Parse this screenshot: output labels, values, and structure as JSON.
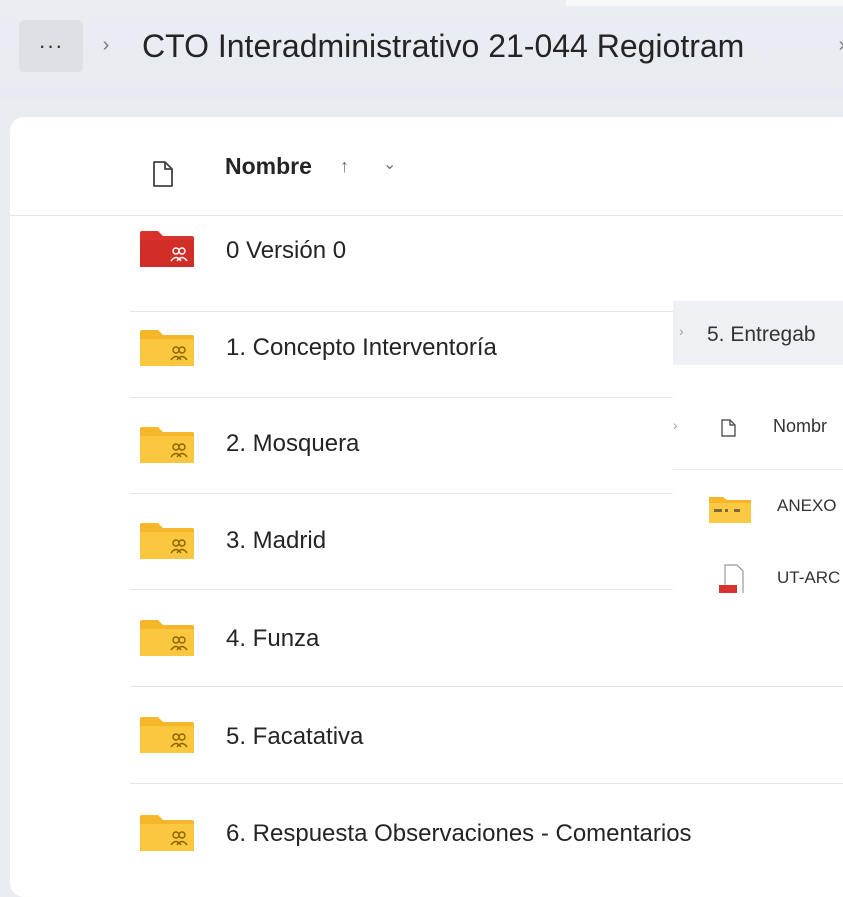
{
  "breadcrumb": {
    "more_label": "···",
    "separator": "›",
    "title": "CTO Interadministrativo 21-044 Regiotram",
    "trailing_separator": "›"
  },
  "list_header": {
    "column_name": "Nombre",
    "sort_arrow": "↑",
    "sort_caret": "⌄"
  },
  "folders": [
    {
      "label": "0 Versión 0",
      "color": "#d9312b"
    },
    {
      "label": "1. Concepto Interventoría",
      "color": "#f5b62a"
    },
    {
      "label": "2. Mosquera",
      "color": "#f5b62a"
    },
    {
      "label": "3. Madrid",
      "color": "#f5b62a"
    },
    {
      "label": "4. Funza",
      "color": "#f5b62a"
    },
    {
      "label": "5. Facatativa",
      "color": "#f5b62a"
    },
    {
      "label": "6. Respuesta Observaciones - Comentarios",
      "color": "#f5b62a"
    }
  ],
  "overlay_window": {
    "separator": "›",
    "breadcrumb": "5. Entregab",
    "header_separator": "›",
    "column_name": "Nombr",
    "items": [
      "ANEXO",
      "UT-ARC"
    ]
  },
  "colors": {
    "folder_yellow": "#f5b62a",
    "folder_red": "#d9312b",
    "panel": "#ffffff",
    "topbar": "#e9ecf1"
  }
}
